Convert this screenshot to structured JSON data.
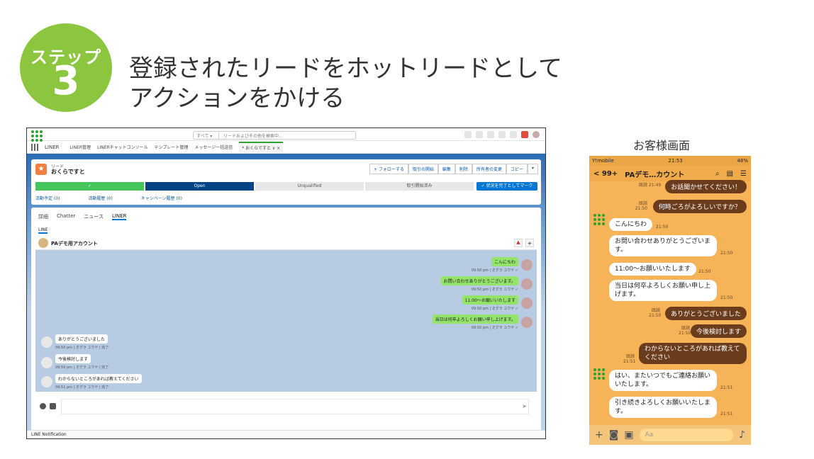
{
  "step": {
    "label": "ステップ",
    "number": "3"
  },
  "headline": {
    "line1": "登録されたリードをホットリードとして",
    "line2": "アクションをかける"
  },
  "salesforce": {
    "search_scope": "すべて ▾",
    "search_placeholder": "リードおよびその他を検索中...",
    "nav": {
      "app": "LINER",
      "items": [
        "LINER管理",
        "LINERチャットコンソール",
        "テンプレート管理",
        "メッセージ一括送信"
      ],
      "active_tab": "* おくらですと ∨ ×"
    },
    "record": {
      "type": "リード",
      "name": "おくらですと",
      "actions": [
        "+ フォローする",
        "取引の開始",
        "編集",
        "削除",
        "所有者の変更",
        "コピー",
        "▾"
      ],
      "path": [
        "✓",
        "Open",
        "Unqualified",
        "取引開始済み"
      ],
      "path_button": "✓ 状況を完了としてマーク",
      "related": [
        "活動予定 (0)",
        "活動履歴 (0)",
        "キャンペーン履歴 (0)"
      ]
    },
    "tabs": [
      "詳細",
      "Chatter",
      "ニュース",
      "LINER"
    ],
    "sub_tab": "LINE",
    "chat": {
      "account": "PAデモ用アカウント",
      "messages": [
        {
          "dir": "out",
          "text": "こんにちわ",
          "meta": "09:50 pm | オグラ ユウヤ ✓"
        },
        {
          "dir": "out",
          "text": "お問い合わせありがとうございます。",
          "meta": "09:50 pm | オグラ ユウヤ ✓"
        },
        {
          "dir": "out",
          "text": "11:00～お願いいたします",
          "meta": "09:50 pm | オグラ ユウヤ ✓"
        },
        {
          "dir": "out",
          "text": "当日は何卒よろしくお願い申し上げます。",
          "meta": "09:50 pm | オグラ ユウヤ ✓"
        },
        {
          "dir": "in",
          "text": "ありがとうございました",
          "meta": "09:50 pm | オグラ ユウヤ | 完了"
        },
        {
          "dir": "in",
          "text": "今後検討します",
          "meta": "09:50 pm | オグラ ユウヤ | 完了"
        },
        {
          "dir": "in",
          "text": "わからないところがあれば教えてください",
          "meta": "09:51 pm | オグラ ユウヤ | 完了"
        }
      ]
    },
    "footer": "LINE Notification"
  },
  "phone": {
    "caption": "お客様画面",
    "status": {
      "carrier": "Y!mobile",
      "time": "21:53",
      "battery": "48%"
    },
    "header": {
      "back": "< 99+",
      "title": "PAデモ…カウント"
    },
    "messages": [
      {
        "dir": "out",
        "text": "お話聞かせてください！",
        "meta": "既読 21:49"
      },
      {
        "dir": "out",
        "text": "何時ごろがよろしいですか？",
        "meta": "既読 21:50"
      },
      {
        "dir": "in",
        "text": "こんにちわ",
        "time": "21:50"
      },
      {
        "dir": "in",
        "text": "お問い合わせありがとうございま す。",
        "time": "21:50"
      },
      {
        "dir": "in",
        "text": "11:00～お願いいたします",
        "time": "21:50"
      },
      {
        "dir": "in",
        "text": "当日は何卒よろしくお願い申し上 げます。",
        "time": "21:50"
      },
      {
        "dir": "out",
        "text": "ありがとうございました",
        "meta": "既読 21:50"
      },
      {
        "dir": "out",
        "text": "今後検討します",
        "meta": "既読 21:50"
      },
      {
        "dir": "out",
        "text": "わからないところがあれば教えて ください",
        "meta": "既読 21:51"
      },
      {
        "dir": "in",
        "text": "はい、またいつでもご連絡お願い いたします。",
        "time": "21:51"
      },
      {
        "dir": "in",
        "text": "引き続きよろしくお願いいたしま す。",
        "time": "21:51"
      }
    ],
    "input_placeholder": "Aa"
  }
}
